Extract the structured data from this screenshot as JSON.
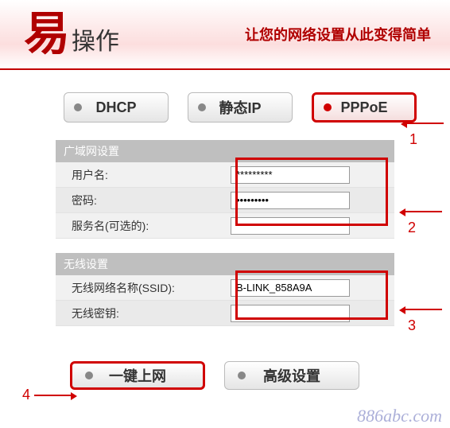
{
  "header": {
    "logo_main": "易",
    "logo_sub": "操作",
    "slogan": "让您的网络设置从此变得简单"
  },
  "tabs": {
    "dhcp": "DHCP",
    "static": "静态IP",
    "pppoe": "PPPoE"
  },
  "wan": {
    "title": "广域网设置",
    "username_label": "用户名:",
    "username_value": "*********",
    "password_label": "密码:",
    "password_value": "•••••••••",
    "service_label": "服务名(可选的):",
    "service_value": ""
  },
  "wifi": {
    "title": "无线设置",
    "ssid_label": "无线网络名称(SSID):",
    "ssid_value": "B-LINK_858A9A",
    "key_label": "无线密钥:",
    "key_value": ""
  },
  "actions": {
    "connect": "一键上网",
    "advanced": "高级设置"
  },
  "callouts": {
    "c1": "1",
    "c2": "2",
    "c3": "3",
    "c4": "4"
  },
  "watermark": "886abc.com"
}
